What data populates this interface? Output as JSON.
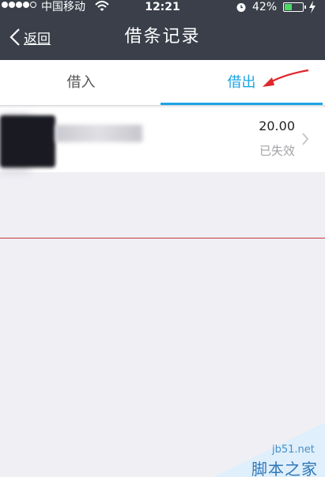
{
  "status_bar": {
    "carrier": "中国移动",
    "time": "12:21",
    "battery_percent": "42%",
    "battery_level": 0.42,
    "signal_bars": 4
  },
  "nav": {
    "back_label": "返回",
    "title": "借条记录"
  },
  "tabs": [
    {
      "label": "借入",
      "selected": false
    },
    {
      "label": "借出",
      "selected": true
    }
  ],
  "records": [
    {
      "amount": "20.00",
      "status": "已失效"
    }
  ],
  "colors": {
    "nav_bg": "#3a3f4a",
    "accent": "#1da4e5",
    "annotation": "#e0262b",
    "page_bg": "#efeff4"
  },
  "watermark": {
    "site": "jb51.net",
    "name": "脚本之家"
  }
}
